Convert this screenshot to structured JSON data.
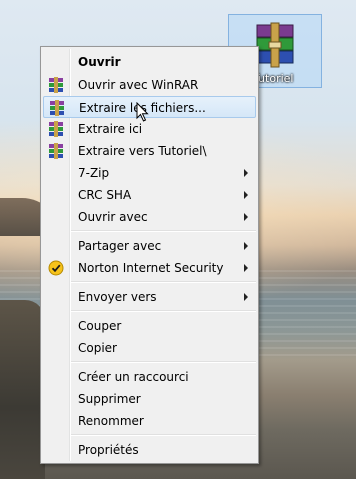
{
  "desktop": {
    "file_icon": {
      "name": "rar-archive-icon",
      "label": "Tutoriel"
    }
  },
  "context_menu": {
    "items": [
      {
        "label": "Ouvrir",
        "bold": true
      },
      {
        "label": "Ouvrir avec WinRAR",
        "icon": "winrar-icon"
      },
      {
        "label": "Extraire les fichiers...",
        "icon": "winrar-icon",
        "highlighted": true
      },
      {
        "label": "Extraire ici",
        "icon": "winrar-icon"
      },
      {
        "label": "Extraire vers Tutoriel\\",
        "icon": "winrar-icon"
      },
      {
        "label": "7-Zip",
        "submenu": true
      },
      {
        "label": "CRC SHA",
        "submenu": true
      },
      {
        "label": "Ouvrir avec",
        "submenu": true
      },
      {
        "label": "Partager avec",
        "submenu": true
      },
      {
        "label": "Norton Internet Security",
        "icon": "norton-icon",
        "submenu": true
      },
      {
        "label": "Envoyer vers",
        "submenu": true
      },
      {
        "label": "Couper"
      },
      {
        "label": "Copier"
      },
      {
        "label": "Créer un raccourci"
      },
      {
        "label": "Supprimer"
      },
      {
        "label": "Renommer"
      },
      {
        "label": "Propriétés"
      }
    ]
  },
  "colors": {
    "menu_bg": "#f0f0f0",
    "highlight_bg": "#d5e7f8",
    "highlight_border": "#a8caec"
  }
}
